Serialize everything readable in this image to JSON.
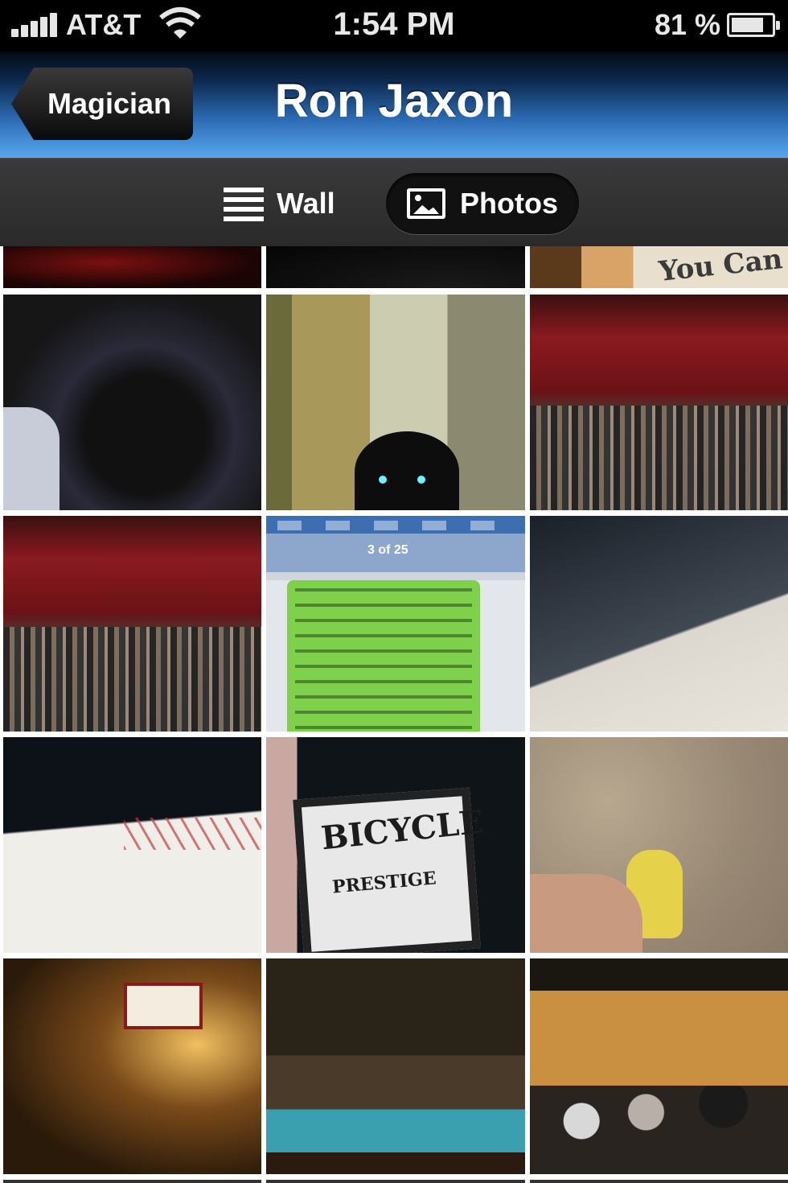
{
  "status_bar": {
    "carrier": "AT&T",
    "time": "1:54 PM",
    "battery_percent": "81 %",
    "battery_level": 0.81,
    "signal_icon": "signal-bars-icon",
    "wifi_icon": "wifi-icon",
    "battery_icon": "battery-icon"
  },
  "nav_bar": {
    "back_label": "Magician",
    "title": "Ron Jaxon"
  },
  "tabs": [
    {
      "label": "Wall",
      "icon": "list-icon",
      "selected": false
    },
    {
      "label": "Photos",
      "icon": "photo-icon",
      "selected": true
    }
  ],
  "photo_grid": {
    "columns": 3,
    "photos": [
      {
        "label": ""
      },
      {
        "label": ""
      },
      {
        "label": "You Can"
      },
      {
        "label": ""
      },
      {
        "label": ""
      },
      {
        "label": ""
      },
      {
        "label": ""
      },
      {
        "label": "3 of 25"
      },
      {
        "label": ""
      },
      {
        "label": ""
      },
      {
        "label": "BICYCLE",
        "sublabel": "PRESTIGE"
      },
      {
        "label": ""
      },
      {
        "label": ""
      },
      {
        "label": ""
      },
      {
        "label": ""
      }
    ]
  },
  "colors": {
    "nav_gradient_top": "#0d2a50",
    "nav_gradient_bottom": "#5aa6ef",
    "tab_bar": "#333333",
    "status_bar": "#000000"
  }
}
